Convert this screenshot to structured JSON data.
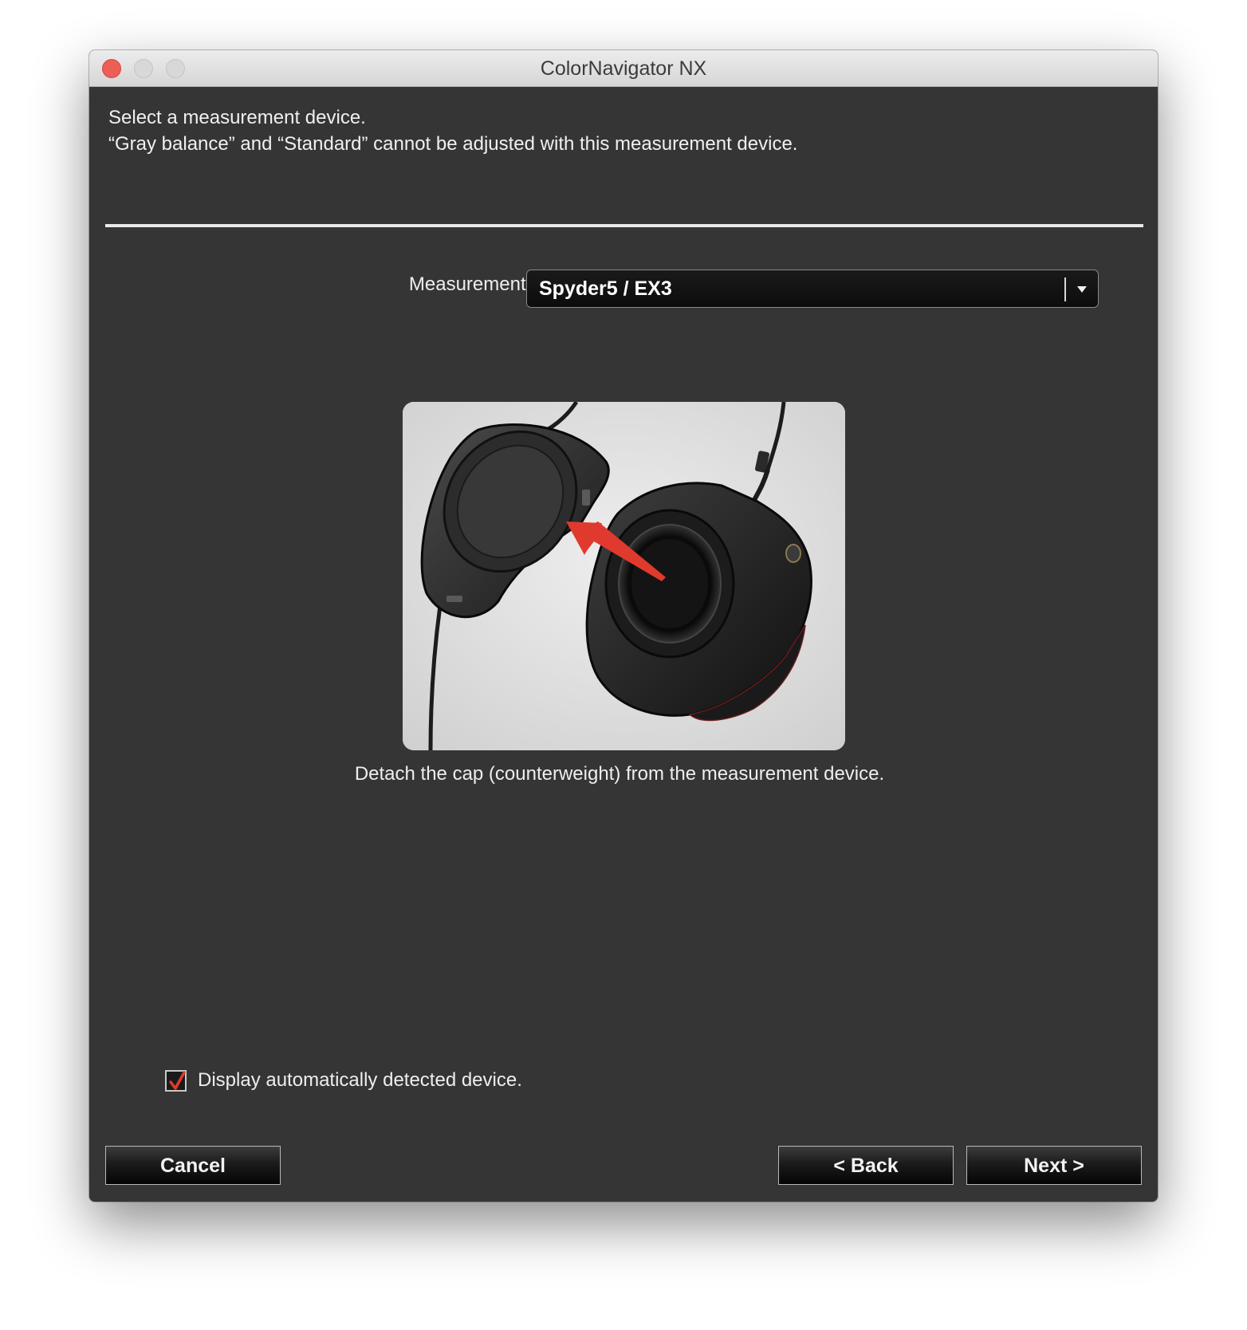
{
  "window": {
    "title": "ColorNavigator NX"
  },
  "instructions": {
    "line1": "Select a measurement device.",
    "line2": "“Gray balance” and “Standard” cannot be adjusted with this measurement device."
  },
  "device": {
    "label": "Measurement device :",
    "selected": "Spyder5 / EX3"
  },
  "illustration": {
    "caption": "Detach the cap (counterweight) from the measurement device."
  },
  "options": {
    "auto_detect_label": "Display automatically detected device.",
    "auto_detect_checked": true
  },
  "buttons": {
    "cancel": "Cancel",
    "back": "< Back",
    "next": "Next >"
  },
  "colors": {
    "window_bg": "#353535",
    "accent_red": "#e03a2e",
    "close_button": "#ec5f57"
  }
}
